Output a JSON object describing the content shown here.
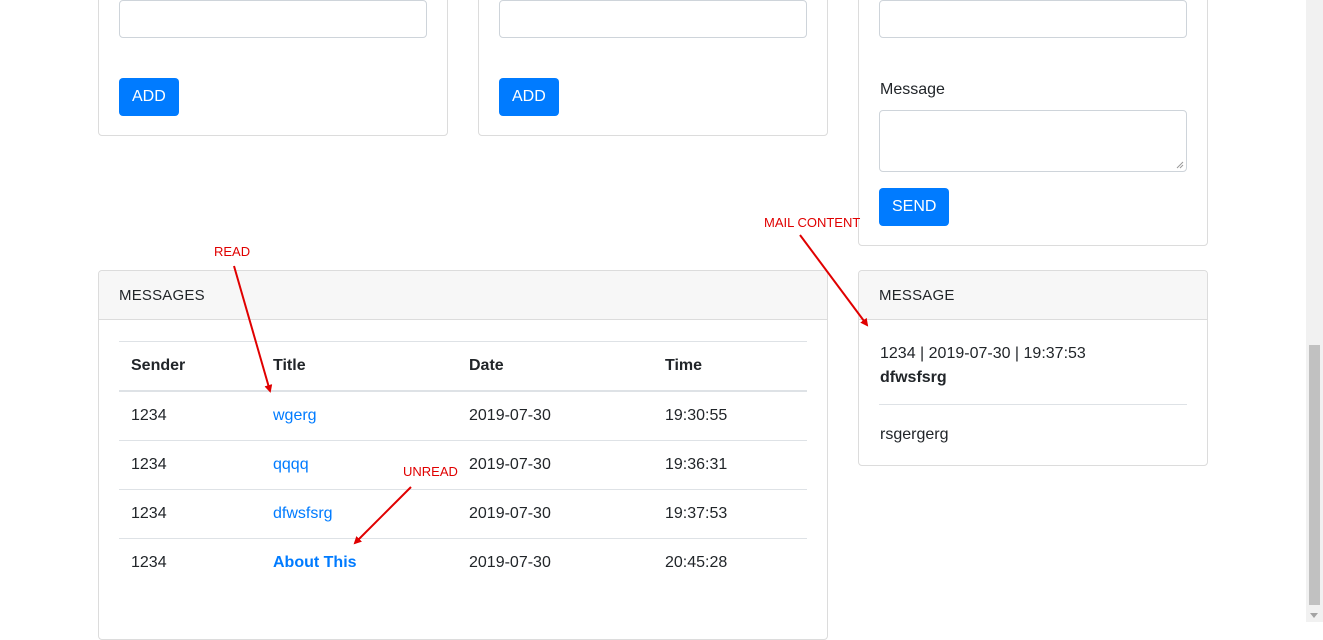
{
  "forms": {
    "left_add_label": "ADD",
    "middle_add_label": "ADD",
    "message_label": "Message",
    "send_label": "SEND"
  },
  "messages": {
    "header": "MESSAGES",
    "columns": [
      "Sender",
      "Title",
      "Date",
      "Time"
    ],
    "rows": [
      {
        "sender": "1234",
        "title": "wgerg",
        "date": "2019-07-30",
        "time": "19:30:55",
        "read": true
      },
      {
        "sender": "1234",
        "title": "qqqq",
        "date": "2019-07-30",
        "time": "19:36:31",
        "read": true
      },
      {
        "sender": "1234",
        "title": "dfwsfsrg",
        "date": "2019-07-30",
        "time": "19:37:53",
        "read": true
      },
      {
        "sender": "1234",
        "title": "About This",
        "date": "2019-07-30",
        "time": "20:45:28",
        "read": false
      }
    ]
  },
  "message_panel": {
    "header": "MESSAGE",
    "meta": "1234 | 2019-07-30 | 19:37:53",
    "subject": "dfwsfsrg",
    "body": "rsgergerg"
  },
  "annotations": {
    "read": "READ",
    "unread": "UNREAD",
    "mail_content": "MAIL CONTENT"
  },
  "colors": {
    "primary": "#007bff",
    "annotation": "#e00000"
  }
}
